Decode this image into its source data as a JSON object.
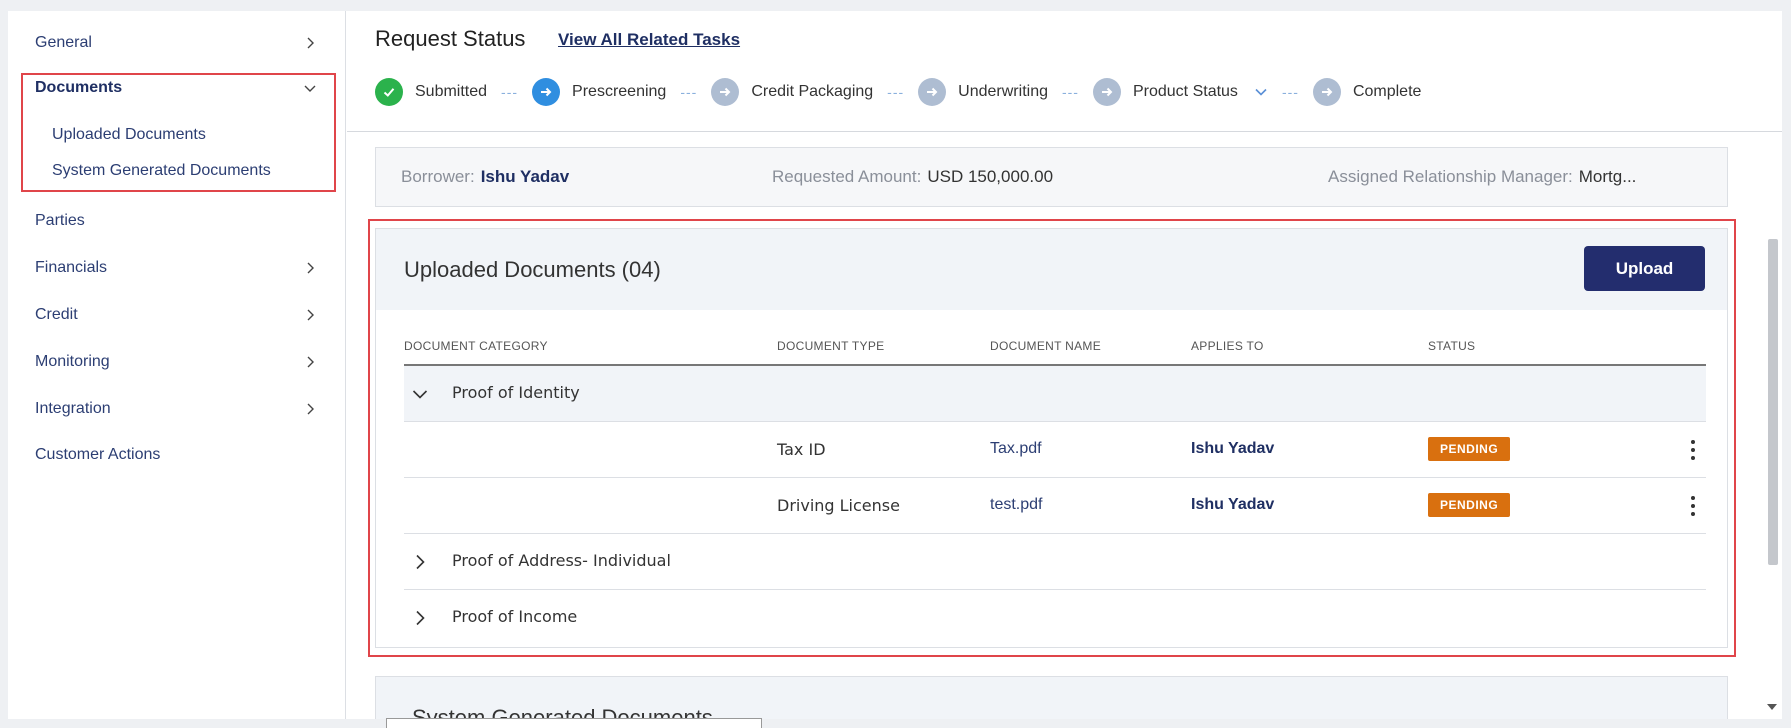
{
  "sidebar": {
    "items": [
      {
        "label": "General",
        "has_chevron": true
      },
      {
        "label": "Documents",
        "expanded": true
      },
      {
        "label": "Parties"
      },
      {
        "label": "Financials",
        "has_chevron": true
      },
      {
        "label": "Credit",
        "has_chevron": true
      },
      {
        "label": "Monitoring",
        "has_chevron": true
      },
      {
        "label": "Integration",
        "has_chevron": true
      },
      {
        "label": "Customer Actions"
      }
    ],
    "documents_sub": [
      "Uploaded Documents",
      "System Generated Documents"
    ]
  },
  "header": {
    "title": "Request Status",
    "link": "View All Related Tasks",
    "steps": [
      {
        "label": "Submitted",
        "state": "done"
      },
      {
        "label": "Prescreening",
        "state": "active"
      },
      {
        "label": "Credit Packaging",
        "state": "todo"
      },
      {
        "label": "Underwriting",
        "state": "todo"
      },
      {
        "label": "Product Status",
        "state": "todo"
      },
      {
        "label": "Complete",
        "state": "todo"
      }
    ],
    "dash": "---"
  },
  "info": {
    "borrower_label": "Borrower:",
    "borrower": "Ishu Yadav",
    "amount_label": "Requested Amount:",
    "amount": "USD 150,000.00",
    "manager_label": "Assigned Relationship Manager:",
    "manager": "Mortg..."
  },
  "uploaded": {
    "title": "Uploaded Documents (04)",
    "upload_label": "Upload",
    "columns": [
      "DOCUMENT CATEGORY",
      "DOCUMENT TYPE",
      "DOCUMENT NAME",
      "APPLIES TO",
      "STATUS"
    ],
    "groups": [
      {
        "label": "Proof of Identity",
        "expanded": true
      },
      {
        "label": "Proof of Address- Individual",
        "expanded": false
      },
      {
        "label": "Proof of Income",
        "expanded": false
      }
    ],
    "rows": [
      {
        "type": "Tax ID",
        "name": "Tax.pdf",
        "applies_to": "Ishu Yadav",
        "status": "PENDING"
      },
      {
        "type": "Driving License",
        "name": "test.pdf",
        "applies_to": "Ishu Yadav",
        "status": "PENDING"
      }
    ]
  },
  "system_generated": {
    "title": "System Generated Documents"
  },
  "colors": {
    "accent": "#232d6e",
    "pending": "#d9700f",
    "done": "#2bb24c",
    "active": "#2f8ee0",
    "highlight": "#e0454a"
  }
}
